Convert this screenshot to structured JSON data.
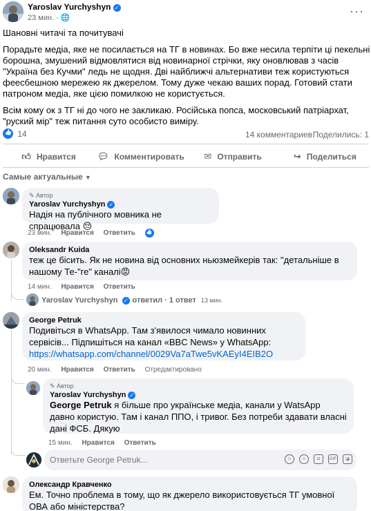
{
  "post": {
    "author": "Yaroslav Yurchyshyn",
    "time": "23 мин.",
    "paragraphs": [
      "Шановні читачі та почитувачі",
      "Порадьте медіа, яке не посилається на ТГ в новинах. Бо вже несила терпіти ці пекельні борошна, змушений відмовлятися від новинарної стрічки, яку оновлював з часів \"Україна без Кучми\" ледь не щодня. Дві найближчі альтернативи теж користуються феесбешною мережею як джерелом. Тому дуже чекаю ваших порад. Готовий стати патроном медіа, яке цією помилкою не користується.",
      "Всім кому ок з ТГ ні до чого не закликаю. Російська попса, московський патріархат, \"руский мір\" теж питання суто особисто виміру."
    ],
    "reactions_count": "14",
    "comments_count": "14 комментариев",
    "shares_label": "Поделилис ь"
  },
  "actions": {
    "like": "Нравится",
    "comment": "Комментировать",
    "send": "Отправить",
    "share": "Поделиться"
  },
  "sort_label": "Самые актуальные",
  "comments": [
    {
      "author_tag": "Автор",
      "author": "Yaroslav Yurchyshyn",
      "text": "Надія на публічного мовника не спрацювала 😔",
      "time": "23 мин.",
      "like": "Нравится",
      "reply": "Ответить"
    },
    {
      "author": "Oleksandr Kuida",
      "text": "теж це бісить. Як не новина від основних ньюзмейкерів так: \"детальніше в нашому Те-\"ге\" каналі😡",
      "time": "14 мин.",
      "like": "Нравится",
      "reply": "Ответить",
      "replies_summary_author": "Yaroslav Yurchyshyn",
      "replies_summary_text": "ответил · 1 ответ",
      "replies_summary_time": "13 мин."
    },
    {
      "author": "George Petruk",
      "text": "Подивіться в WhatsApp. Там з'явилося чимало новинних сервісів... Підпишіться на канал «BBC News» у WhatsApp: ",
      "link": "https://whatsapp.com/channel/0029Va7aTwe5vKAEyI4EIB2O",
      "time": "20 мин.",
      "like": "Нравится",
      "reply": "Ответить",
      "translation": "Отредактировано"
    },
    {
      "author_tag": "Автор",
      "author": "Yaroslav Yurchyshyn",
      "mention": "George Petruk",
      "text": " я більше про українське медіа, канали у WatsApp давно користую. Там і канал ППО, і тривог. Без потреби здавати власні дані ФСБ. Дякую",
      "time": "15 мин.",
      "like": "Нравится",
      "reply": "Ответить"
    },
    {
      "author": "Олександр Кравченко",
      "text": "Ем. Точно проблема в тому, що як джерело використовується ТГ умовної ОВА або міністерства?"
    }
  ],
  "reply_box": {
    "placeholder": "Ответьте George Petruk..."
  }
}
